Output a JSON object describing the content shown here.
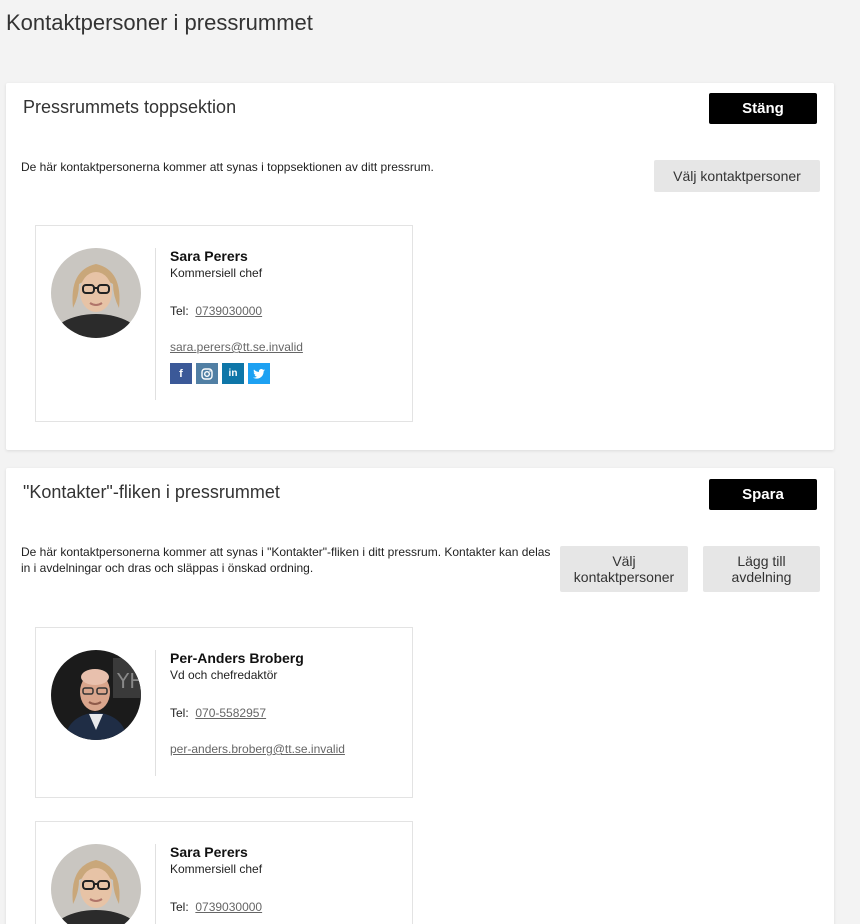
{
  "page": {
    "title": "Kontaktpersoner i pressrummet"
  },
  "top_section": {
    "title": "Pressrummets toppsektion",
    "close_label": "Stäng",
    "description": "De här kontaktpersonerna kommer att synas i toppsektionen av ditt pressrum.",
    "choose_label": "Välj kontaktpersoner",
    "contacts": [
      {
        "name": "Sara Perers",
        "role": "Kommersiell chef",
        "tel_label": "Tel:",
        "tel": "0739030000",
        "email": "sara.perers@tt.se.invalid",
        "socials": [
          "facebook-icon",
          "instagram-icon",
          "linkedin-icon",
          "twitter-icon"
        ],
        "social_colors": [
          "#3b5998",
          "#517fa4",
          "#0e76a8",
          "#1da1f2"
        ]
      }
    ]
  },
  "contacts_tab": {
    "title": "\"Kontakter\"-fliken i pressrummet",
    "save_label": "Spara",
    "description": "De här kontaktpersonerna kommer att synas i \"Kontakter\"-fliken i ditt pressrum. Kontakter kan delas in i avdelningar och dras och släppas i önskad ordning.",
    "choose_label": "Välj kontaktpersoner",
    "add_department_label": "Lägg till avdelning",
    "contacts": [
      {
        "name": "Per-Anders Broberg",
        "role": "Vd och chefredaktör",
        "tel_label": "Tel:",
        "tel": "070-5582957",
        "email": "per-anders.broberg@tt.se.invalid"
      },
      {
        "name": "Sara Perers",
        "role": "Kommersiell chef",
        "tel_label": "Tel:",
        "tel": "0739030000"
      }
    ]
  }
}
